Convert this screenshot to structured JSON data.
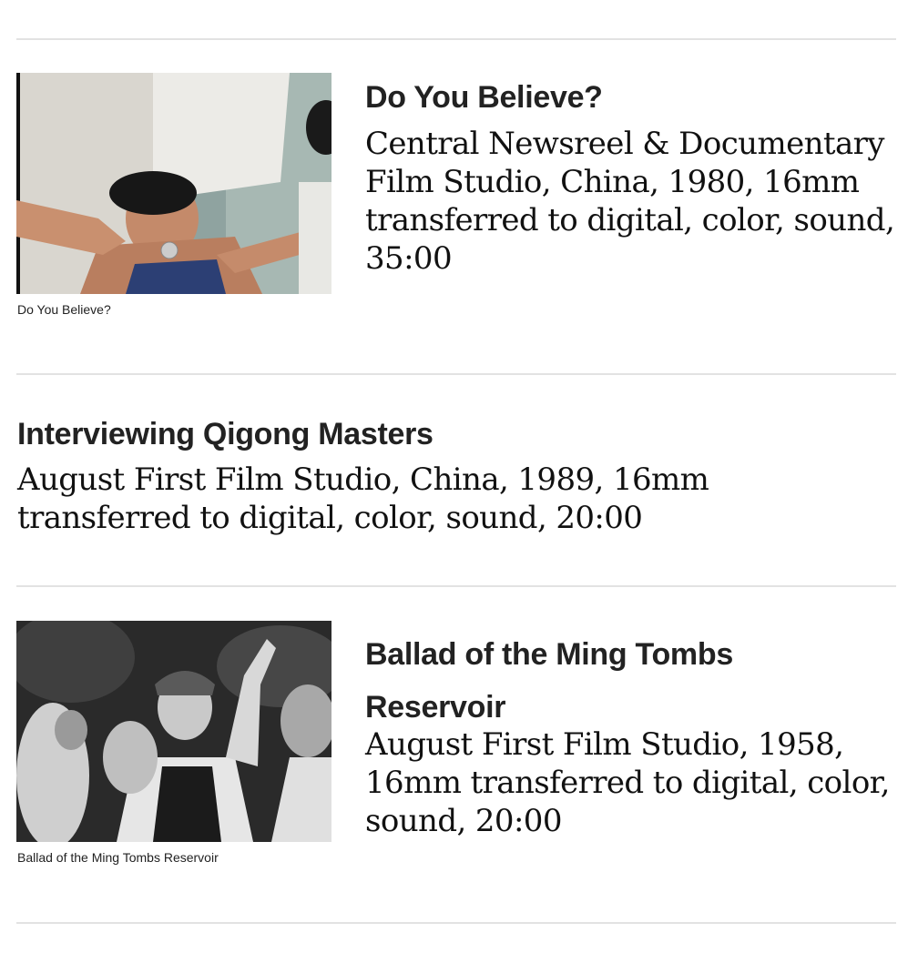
{
  "films": [
    {
      "title": "Do You Believe?",
      "details": "Central Newsreel & Documentary Film Studio, China, 1980, 16mm transferred to digital, color, sound, 35:00",
      "caption": "Do You Believe?",
      "has_image": true
    },
    {
      "title": "Interviewing Qigong Masters",
      "details": "August First Film Studio, China, 1989, 16mm transferred to digital, color, sound, 20:00",
      "has_image": false
    },
    {
      "title": "Ballad of the Ming Tombs Reservoir",
      "details": "August First Film Studio, 1958, 16mm transferred to digital, color, sound, 20:00",
      "caption": "Ballad of the Ming Tombs Reservoir",
      "has_image": true
    }
  ],
  "colors": {
    "divider": "#e2e2e2",
    "text": "#222222"
  }
}
